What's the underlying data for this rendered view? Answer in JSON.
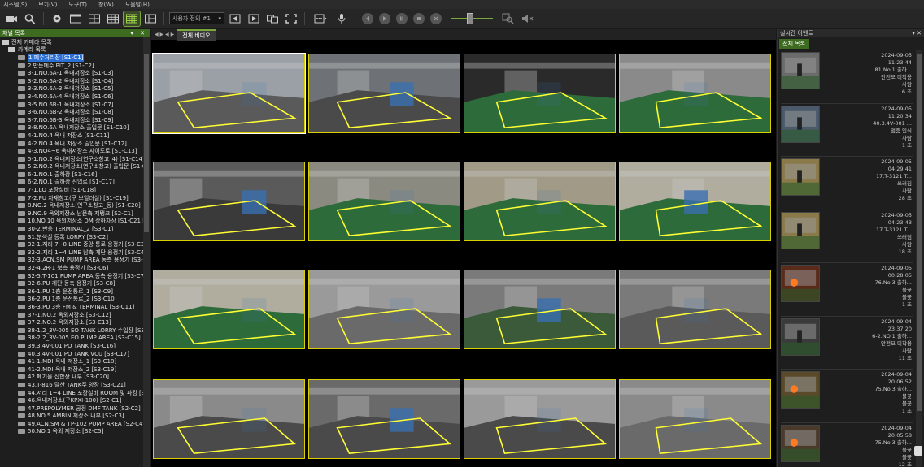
{
  "menu": [
    "시스템(S)",
    "보기(V)",
    "도구(T)",
    "창(W)",
    "도움말(H)"
  ],
  "toolbar": {
    "sequence_select": "사용자 정의 #1",
    "accent": "#7aa83a"
  },
  "left_panel": {
    "title": "채널 목록",
    "root": "전체 카메라 목록",
    "group": "카메라 목록",
    "cameras": [
      "1.폐수처리장 [S1-C1]",
      "2.만든폐수 PIT_2 [S1-C2]",
      "3-1.NO.6A-1 옥내저장소 [S1-C3]",
      "3-2.NO.6A-2 옥내저장소 [S1-C4]",
      "3-3.NO.6A-3 옥내저장소 [S1-C5]",
      "3-4.NO.6A-4 옥내저장소 [S1-C6]",
      "3-5.NO.6B-1 옥내저장소 [S1-C7]",
      "3-6.NO.6B-2 옥내저장소 [S1-C8]",
      "3-7.NO.6B-3 옥내저장소 [S1-C9]",
      "3-8.NO.6A 옥내저장소 출입문 [S1-C10]",
      "4-1.NO.4 옥내 저장소 [S1-C11]",
      "4-2.NO.4 옥내 저장소 출입문 [S1-C12]",
      "4-3.NO4~6 옥내저장소 사이도로 [S1-C13]",
      "5-1.NO.2 옥내저장소(연구소창고_4) [S1-C14]",
      "5-2.NO.2 옥내저장소(연구소창고) 출입문 [S1-C]",
      "6-1.NO.1 출하장 [S1-C16]",
      "6-2.NO.1 출하장 진입로 [S1-C17]",
      "7-1.LQ 포장설비 [S1-C18]",
      "7-2.PU 자재창고(구 보일러실) [S1-C19]",
      "8.NO.2 옥내저장소(연구소창고_동) [S1-C20]",
      "9.NO.9 옥외저장소 남문측 저탱크 [S2-C1]",
      "10.NO.10 옥외저장소 DM 상하차장 [S1-C21]",
      "30-2.반응 TERMINAL_2 [S3-C1]",
      "31.분석실 등록 LORRY [S3-C2]",
      "32-1.저리 7~8 LINE 중앙 통로 용정기 [S3-C3]",
      "32-2.저리 1~4 LINE 남측 계단 용정기 [S3-C4]",
      "32-3.ACN,SM PUMP AREA 동측 용정기 [S3-C5]",
      "32-4.2R-1 북측 용정기 [S3-C6]",
      "32-5.T-101 PUMP AREA 동측 용정기 [S3-C7]",
      "32-6.PU 계단 동측 용정기 [S3-C8]",
      "36-1.PU 1층 운전통로_1 [S3-C9]",
      "36-2.PU 1층 운전통로_2 [S3-C10]",
      "36-3.PU 3층 FM & TERMINAL [S3-C11]",
      "37-1.NO.2 옥외저장소 [S3-C12]",
      "37-2.NO.2 옥외저장소 [S3-C13]",
      "38-1.2_3V-005 EO TANK LORRY 수입장 [S3-C14]",
      "38-2.2_3V-005 EO PUMP AREA [S3-C15]",
      "39.3.4V-001 PO TANK [S3-C16]",
      "40.3.4V-001 PO TANK VCU [S3-C17]",
      "41-1.MDI 옥내 저장소_1 [S3-C18]",
      "41-2.MDI 옥내 저장소_2 [S3-C19]",
      "42.폐기물 집합장 내부 [S3-C20]",
      "43.T-816 탈산 TANK주 양장 [S3-C21]",
      "44.저리 1~4 LINE 포장설비 ROOM 및 파킹 [S4-C1]",
      "46.옥내저장소(구KPXI-100) [S2-C1]",
      "47.PREPOLYMER 공정 DMF TANK [S2-C2]",
      "48.NO.5 AMBIN 저장소 내부 [S2-C3]",
      "49.ACN,SM & TP-102 PUMP AREA [S2-C4]",
      "50.NO.1 옥외 저장소 [S2-C5]"
    ]
  },
  "center": {
    "tab": "전체 비디오"
  },
  "right_panel": {
    "title": "실시간 이벤트",
    "tab": "전체 목록",
    "events": [
      {
        "date": "2024-09-05",
        "time": "11:23:44",
        "camera": "81.No.1 출하...",
        "type": "안전모 미착용",
        "count_label": "사람",
        "duration": "6 초"
      },
      {
        "date": "2024-09-05",
        "time": "11:20:34",
        "camera": "40.3.4V-001 ...",
        "type": "멈춤 인식",
        "count_label": "사람",
        "duration": "1 초"
      },
      {
        "date": "2024-09-05",
        "time": "04:29:41",
        "camera": "17.T-3121 T...",
        "type": "쓰러짐",
        "count_label": "사람",
        "duration": "28 초"
      },
      {
        "date": "2024-09-05",
        "time": "04:23:43",
        "camera": "17.T-3121 T...",
        "type": "쓰러짐",
        "count_label": "사람",
        "duration": "18 초"
      },
      {
        "date": "2024-09-05",
        "time": "00:28:05",
        "camera": "76.No.3 출하...",
        "type": "불꽃",
        "count_label": "불꽃",
        "duration": "1 초"
      },
      {
        "date": "2024-09-04",
        "time": "23:37:20",
        "camera": "6-2.NO.1 출하...",
        "type": "안전모 미착용",
        "count_label": "사람",
        "duration": "11 초"
      },
      {
        "date": "2024-09-04",
        "time": "20:06:52",
        "camera": "75.No.3 출하...",
        "type": "불꽃",
        "count_label": "불꽃",
        "duration": "1 초"
      },
      {
        "date": "2024-09-04",
        "time": "20:05:58",
        "camera": "75.No.3 출하...",
        "type": "불꽃",
        "count_label": "불꽃",
        "duration": "12 초"
      }
    ]
  }
}
